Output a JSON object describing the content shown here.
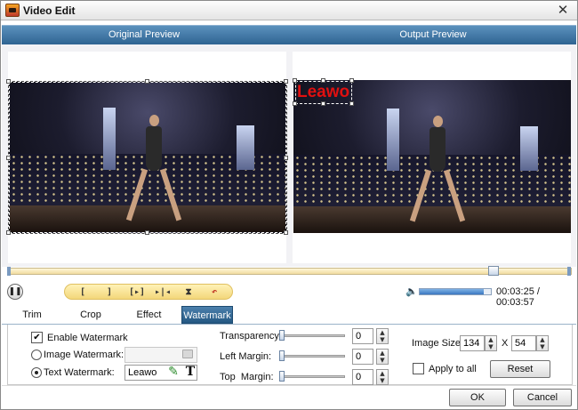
{
  "window": {
    "title": "Video Edit",
    "close_glyph": "✕"
  },
  "preview": {
    "original_label": "Original Preview",
    "output_label": "Output Preview"
  },
  "watermark_overlay": {
    "text": "Leawo",
    "color": "#e01010"
  },
  "playback": {
    "pause_glyph": "❚❚",
    "buttons": [
      {
        "name": "mark-in-button",
        "label": "["
      },
      {
        "name": "mark-out-button",
        "label": "]"
      },
      {
        "name": "play-segment-button",
        "label": "[▸]"
      },
      {
        "name": "go-to-marks-button",
        "label": "▸|◂"
      },
      {
        "name": "split-button",
        "label": "⧗"
      },
      {
        "name": "undo-button",
        "label": "↶"
      }
    ],
    "volume_glyph": "🔈",
    "volume_level": 0.9,
    "time_display": "00:03:25 / 00:03:57",
    "progress_fraction": 0.87
  },
  "tabs": [
    {
      "name": "tab-trim",
      "label": "Trim"
    },
    {
      "name": "tab-crop",
      "label": "Crop"
    },
    {
      "name": "tab-effect",
      "label": "Effect"
    },
    {
      "name": "tab-watermark",
      "label": "Watermark",
      "active": true
    }
  ],
  "watermark": {
    "enable_label": "Enable Watermark",
    "enable_checked": "✔",
    "image_label": "Image Watermark:",
    "image_value": "",
    "text_label": "Text Watermark:",
    "text_value": "Leawo",
    "pencil_glyph": "✎",
    "t_glyph": "T"
  },
  "adjustments": {
    "transparency_label": "Transparency:",
    "transparency_value": "0",
    "left_margin_label": "Left Margin:",
    "left_margin_value": "0",
    "top_margin_label": "Top  Margin:",
    "top_margin_value": "0"
  },
  "image_size": {
    "label": "Image Size:",
    "width": "134",
    "x_label": "X",
    "height": "54",
    "apply_all_label": "Apply to all",
    "reset_label": "Reset"
  },
  "dialog": {
    "ok_label": "OK",
    "cancel_label": "Cancel"
  },
  "spin_glyphs": {
    "up": "▲",
    "down": "▼"
  },
  "colors": {
    "header_blue": "#2f6492",
    "tab_active": "#245883",
    "progress_fill": "#f1dca0"
  }
}
